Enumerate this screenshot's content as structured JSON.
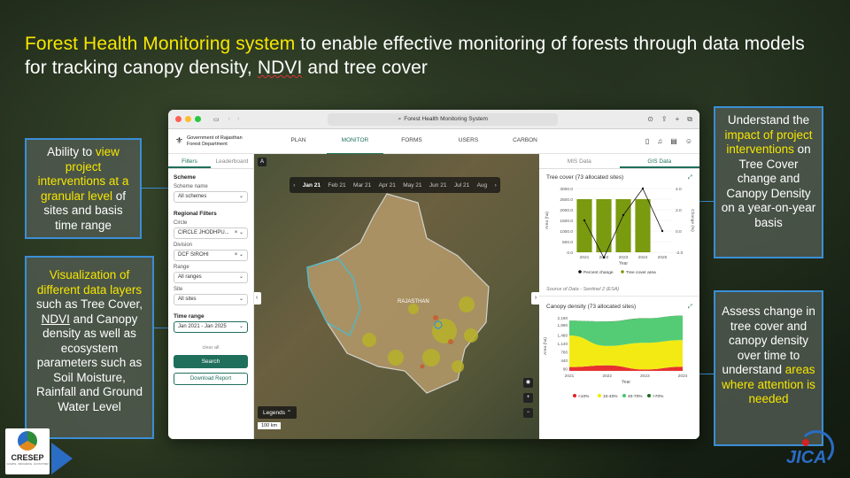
{
  "headline": {
    "highlight": "Forest Health Monitoring system",
    "text1": " to enable effective monitoring of forests through data models for tracking canopy density, ",
    "ndvi": "NDVI",
    "text2": " and tree cover"
  },
  "callouts": {
    "left_top": {
      "a": "Ability to ",
      "b": "view project interventions at a granular level",
      "c": " of sites and basis time range"
    },
    "left_bottom": {
      "a": "Visualization of different data layers",
      "b": " such as Tree Cover, ",
      "c": "NDVI",
      "d": " and Canopy density as well as ecosystem parameters such as Soil Moisture, Rainfall and Ground Water Level"
    },
    "right_top": {
      "a": "Understand the ",
      "b": "impact of project interventions",
      "c": " on Tree Cover change and Canopy Density on a year-on-year basis"
    },
    "right_bottom": {
      "a": "Assess change in tree cover and canopy density over time to understand ",
      "b": "areas where attention is needed"
    }
  },
  "logos": {
    "cresep": "CRESEP",
    "cresep_tag": "CLIMATE · RESILIENCE · ECOSYSTEM",
    "jica": "JICA"
  },
  "browser": {
    "url": "Forest Health Monitoring System"
  },
  "app": {
    "gov_line1": "Government of Rajasthan",
    "gov_line2": "Forest Department",
    "nav": [
      "PLAN",
      "MONITOR",
      "FORMS",
      "USERS",
      "CARBON"
    ],
    "active_nav": "MONITOR"
  },
  "sidebar": {
    "tabs": [
      "Filters",
      "Leaderboard"
    ],
    "scheme_title": "Scheme",
    "scheme_label": "Scheme name",
    "scheme_value": "All schemes",
    "regional_title": "Regional Filters",
    "circle_label": "Circle",
    "circle_value": "CIRCLE JHODHPU...",
    "division_label": "Division",
    "division_value": "DCF SIROHI",
    "range_label": "Range",
    "range_value": "All ranges",
    "site_label": "Site",
    "site_value": "All sites",
    "time_title": "Time range",
    "time_value": "Jan 2021 - Jan 2025",
    "clear": "clear all",
    "search": "Search",
    "download": "Download Report"
  },
  "map": {
    "months": [
      "Jan 21",
      "Feb 21",
      "Mar 21",
      "Apr 21",
      "May 21",
      "Jun 21",
      "Jul 21",
      "Aug"
    ],
    "active_month": "Jan 21",
    "region_label": "RAJASTHAN",
    "legends": "Legends",
    "scale": "100 km"
  },
  "rpanel": {
    "tabs": [
      "MIS Data",
      "GIS Data"
    ],
    "active_tab": "GIS Data",
    "chart1_title": "Tree cover (73 allocated sites)",
    "chart1_source": "Source of Data - Sentinel 2 (ESA)",
    "chart2_title": "Canopy density (73 allocated sites)"
  },
  "chart_data": [
    {
      "type": "bar",
      "title": "Tree cover (73 allocated sites)",
      "categories": [
        "2021",
        "2022",
        "2023",
        "2024",
        "2025"
      ],
      "series": [
        {
          "name": "Tree cover area",
          "values": [
            2500,
            2500,
            2500,
            2500,
            0
          ],
          "color": "#7a9a10"
        },
        {
          "name": "Percent change",
          "values": [
            1.0,
            -2.5,
            1.5,
            4.0,
            0.0
          ],
          "color": "#111111",
          "kind": "line"
        }
      ],
      "ylabel": "Area (ha)",
      "y2label": "Change (%)",
      "xlabel": "Year",
      "ylim": [
        0,
        3000
      ],
      "y2lim": [
        -2,
        4
      ],
      "yticks": [
        "3000.0",
        "2500.0",
        "2000.0",
        "1500.0",
        "1000.0",
        "500.0",
        "0.0"
      ],
      "y2ticks": [
        "4.0",
        "2.0",
        "0.0",
        "-2.0"
      ]
    },
    {
      "type": "area",
      "title": "Canopy density (73 allocated sites)",
      "x": [
        "2021",
        "2022",
        "2023",
        "2024"
      ],
      "series": [
        {
          "name": "<10%",
          "values": [
            160,
            230,
            60,
            170
          ],
          "color": "#e52020"
        },
        {
          "name": "10-40%",
          "values": [
            1300,
            800,
            1100,
            1100
          ],
          "color": "#f2e800"
        },
        {
          "name": "40-70%",
          "values": [
            600,
            1000,
            1000,
            1000
          ],
          "color": "#45c86a"
        },
        {
          "name": ">70%",
          "values": [
            10,
            10,
            10,
            10
          ],
          "color": "#1d6e1d"
        }
      ],
      "ylabel": "Area (ha)",
      "xlabel": "Year",
      "ylim": [
        0,
        2190
      ],
      "yticks": [
        "2,190",
        "1,890",
        "1,480",
        "1,140",
        "780",
        "440",
        "90"
      ]
    }
  ]
}
